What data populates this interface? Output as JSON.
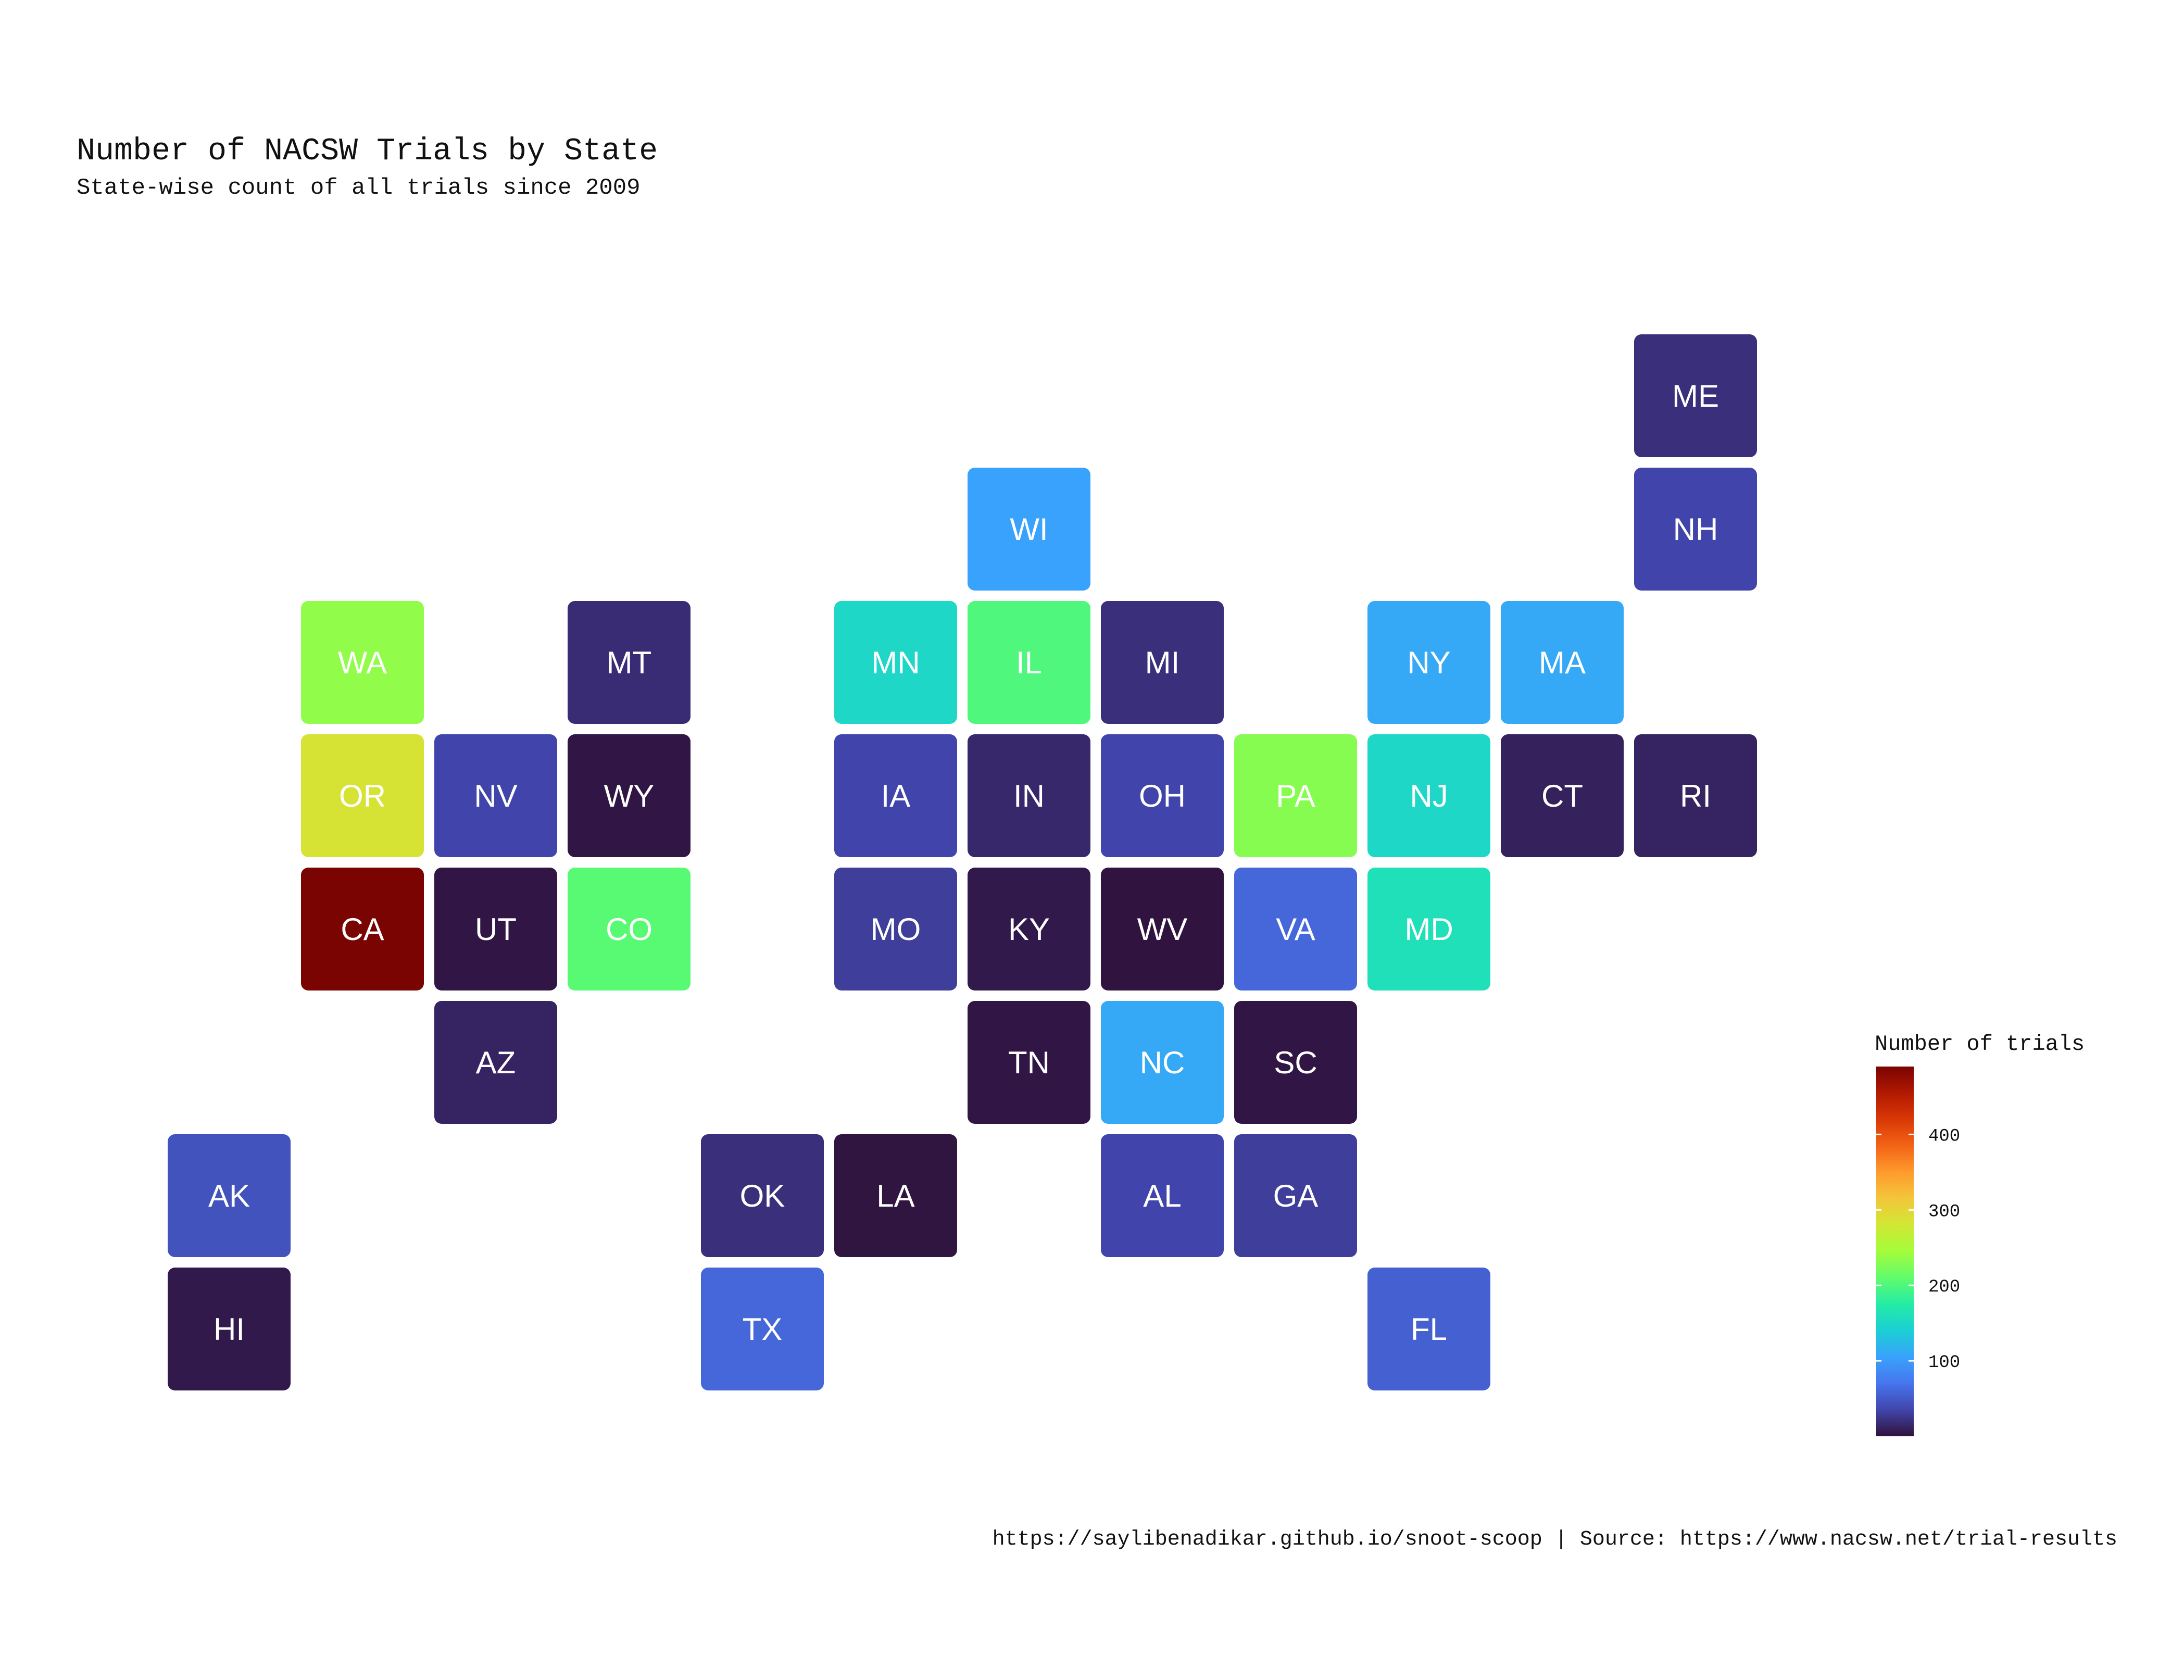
{
  "chart_data": {
    "type": "heatmap",
    "title": "Number of NACSW Trials by State",
    "subtitle": "State-wise count of all trials since 2009",
    "caption": "https://saylibenadikar.github.io/snoot-scoop | Source: https://www.nacsw.net/trial-results",
    "legend": {
      "title": "Number of trials",
      "min": 0,
      "max": 490,
      "ticks": [
        100,
        200,
        300,
        400
      ],
      "placement": "right"
    },
    "colorscale": [
      "#30123b",
      "#4145ab",
      "#4675ed",
      "#39a2fc",
      "#1bcfd4",
      "#24eca6",
      "#61fc6c",
      "#a4fc3b",
      "#d1e834",
      "#f3c63a",
      "#fe9b2d",
      "#f36315",
      "#d93806",
      "#b11901",
      "#7a0402"
    ],
    "states": [
      {
        "abbr": "ME",
        "col": 11,
        "row": 0,
        "value": 20
      },
      {
        "abbr": "WI",
        "col": 6,
        "row": 1,
        "value": 105
      },
      {
        "abbr": "NH",
        "col": 11,
        "row": 1,
        "value": 35
      },
      {
        "abbr": "WA",
        "col": 1,
        "row": 2,
        "value": 235
      },
      {
        "abbr": "MT",
        "col": 3,
        "row": 2,
        "value": 18
      },
      {
        "abbr": "MN",
        "col": 5,
        "row": 2,
        "value": 150
      },
      {
        "abbr": "IL",
        "col": 6,
        "row": 2,
        "value": 200
      },
      {
        "abbr": "MI",
        "col": 7,
        "row": 2,
        "value": 20
      },
      {
        "abbr": "NY",
        "col": 9,
        "row": 2,
        "value": 110
      },
      {
        "abbr": "MA",
        "col": 10,
        "row": 2,
        "value": 110
      },
      {
        "abbr": "OR",
        "col": 1,
        "row": 3,
        "value": 285
      },
      {
        "abbr": "NV",
        "col": 2,
        "row": 3,
        "value": 35
      },
      {
        "abbr": "WY",
        "col": 3,
        "row": 3,
        "value": 3
      },
      {
        "abbr": "IA",
        "col": 5,
        "row": 3,
        "value": 35
      },
      {
        "abbr": "IN",
        "col": 6,
        "row": 3,
        "value": 15
      },
      {
        "abbr": "OH",
        "col": 7,
        "row": 3,
        "value": 35
      },
      {
        "abbr": "PA",
        "col": 8,
        "row": 3,
        "value": 230
      },
      {
        "abbr": "NJ",
        "col": 9,
        "row": 3,
        "value": 150
      },
      {
        "abbr": "CT",
        "col": 10,
        "row": 3,
        "value": 10
      },
      {
        "abbr": "RI",
        "col": 11,
        "row": 3,
        "value": 12
      },
      {
        "abbr": "CA",
        "col": 1,
        "row": 4,
        "value": 490
      },
      {
        "abbr": "UT",
        "col": 2,
        "row": 4,
        "value": 3
      },
      {
        "abbr": "CO",
        "col": 3,
        "row": 4,
        "value": 205
      },
      {
        "abbr": "MO",
        "col": 5,
        "row": 4,
        "value": 30
      },
      {
        "abbr": "KY",
        "col": 6,
        "row": 4,
        "value": 5
      },
      {
        "abbr": "WV",
        "col": 7,
        "row": 4,
        "value": 1
      },
      {
        "abbr": "VA",
        "col": 8,
        "row": 4,
        "value": 60
      },
      {
        "abbr": "MD",
        "col": 9,
        "row": 4,
        "value": 160
      },
      {
        "abbr": "AZ",
        "col": 2,
        "row": 5,
        "value": 12
      },
      {
        "abbr": "TN",
        "col": 6,
        "row": 5,
        "value": 3
      },
      {
        "abbr": "NC",
        "col": 7,
        "row": 5,
        "value": 110
      },
      {
        "abbr": "SC",
        "col": 8,
        "row": 5,
        "value": 3
      },
      {
        "abbr": "AK",
        "col": 0,
        "row": 6,
        "value": 45
      },
      {
        "abbr": "OK",
        "col": 4,
        "row": 6,
        "value": 20
      },
      {
        "abbr": "LA",
        "col": 5,
        "row": 6,
        "value": 2
      },
      {
        "abbr": "AL",
        "col": 7,
        "row": 6,
        "value": 35
      },
      {
        "abbr": "GA",
        "col": 8,
        "row": 6,
        "value": 30
      },
      {
        "abbr": "HI",
        "col": 0,
        "row": 7,
        "value": 5
      },
      {
        "abbr": "TX",
        "col": 4,
        "row": 7,
        "value": 60
      },
      {
        "abbr": "FL",
        "col": 9,
        "row": 7,
        "value": 55
      }
    ]
  }
}
